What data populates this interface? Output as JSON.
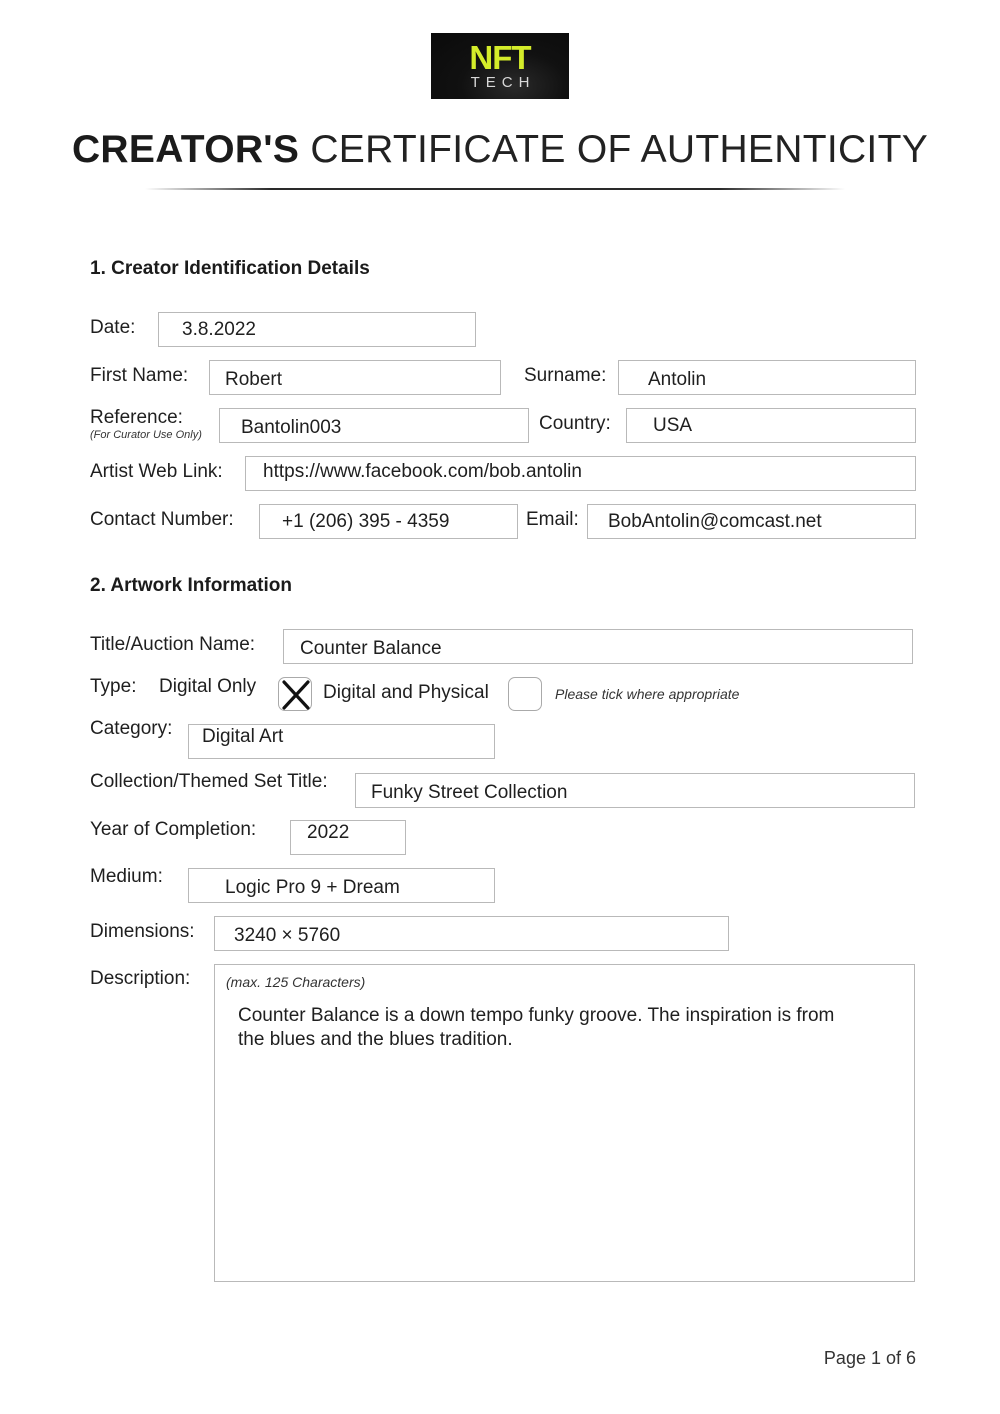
{
  "logo": {
    "line1": "NFT",
    "line2": "TECH"
  },
  "header": {
    "title_bold": "CREATOR'S",
    "title_rest": " CERTIFICATE OF AUTHENTICITY"
  },
  "section1": {
    "title": "1. Creator Identification Details",
    "date": {
      "label": "Date:",
      "value": "3.8.2022"
    },
    "first_name": {
      "label": "First Name:",
      "value": "Robert"
    },
    "surname": {
      "label": "Surname:",
      "value": "Antolin"
    },
    "reference": {
      "label": "Reference:",
      "sublabel": "(For Curator Use Only)",
      "value": "Bantolin003"
    },
    "country": {
      "label": "Country:",
      "value": "USA"
    },
    "web_link": {
      "label": "Artist Web Link:",
      "value": "https://www.facebook.com/bob.antolin"
    },
    "contact": {
      "label": "Contact Number:",
      "value": "+1 (206) 395 - 4359"
    },
    "email": {
      "label": "Email:",
      "value": "BobAntolin@comcast.net"
    }
  },
  "section2": {
    "title": "2. Artwork Information",
    "auction_name": {
      "label": "Title/Auction Name:",
      "value": "Counter Balance"
    },
    "type": {
      "label": "Type:",
      "options": [
        {
          "label": "Digital Only",
          "checked": true
        },
        {
          "label": "Digital and Physical",
          "checked": false
        }
      ],
      "hint": "Please tick where appropriate"
    },
    "category": {
      "label": "Category:",
      "value": "Digital Art"
    },
    "collection": {
      "label": "Collection/Themed Set Title:",
      "value": "Funky Street Collection"
    },
    "year": {
      "label": "Year of Completion:",
      "value": "2022"
    },
    "medium": {
      "label": "Medium:",
      "value": "Logic Pro 9 + Dream"
    },
    "dimensions": {
      "label": "Dimensions:",
      "value": "3240 × 5760"
    },
    "description": {
      "label": "Description:",
      "hint": "(max. 125 Characters)",
      "value": "Counter Balance is a down tempo funky groove. The inspiration is from the blues and the blues tradition."
    }
  },
  "footer": {
    "page": "Page 1 of 6"
  }
}
